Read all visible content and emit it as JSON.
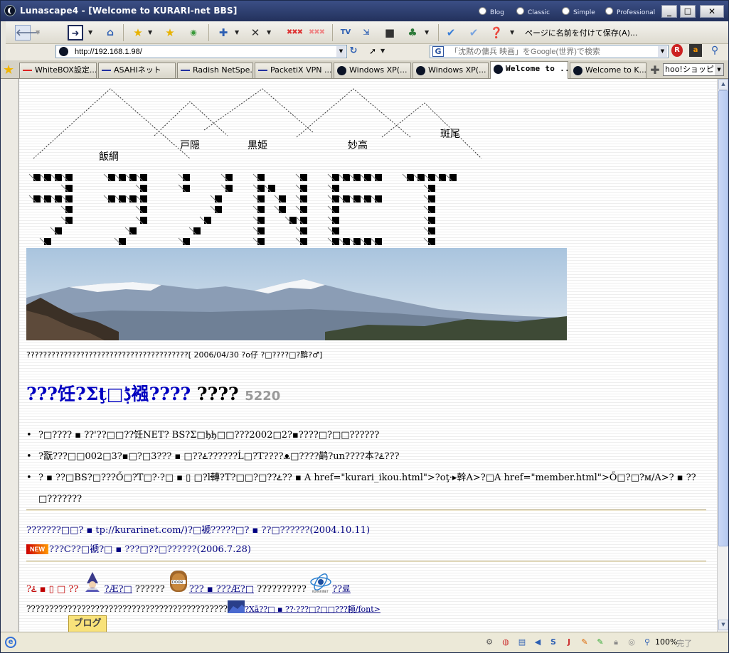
{
  "window": {
    "title": "Lunascape4 - [Welcome to KURARI-net BBS]",
    "modes": [
      "Blog",
      "Classic",
      "Simple",
      "Professional"
    ],
    "controls": {
      "minimize": "_",
      "maximize": "□",
      "close": "✕"
    }
  },
  "toolbar": {
    "save_label": "ページに名前を付けて保存(A)..."
  },
  "address": {
    "url": "http://192.168.1.98/",
    "search_placeholder": "「沈黙の傭兵 映画」をGoogle(世界)で検索"
  },
  "tabs": [
    {
      "label": "WhiteBOX設定...",
      "icon_color": "#d22"
    },
    {
      "label": "ASAHIネット",
      "icon_color": "#2230a0"
    },
    {
      "label": "Radish NetSpe...",
      "icon_color": "#2230a0"
    },
    {
      "label": "PacketiX VPN ...",
      "icon_color": "#2230a0"
    },
    {
      "label": "Windows XP(...",
      "icon_color": "#0b1326"
    },
    {
      "label": "Windows XP(...",
      "icon_color": "#0b1326"
    },
    {
      "label": "Welcome to ...",
      "icon_color": "#0b1326",
      "active": true
    },
    {
      "label": "Welcome to K...",
      "icon_color": "#0b1326"
    }
  ],
  "shopping_label": "hoo!ショッピング",
  "logo": {
    "peaks": [
      "飯綱",
      "戸隠",
      "黒姫",
      "妙高",
      "斑尾"
    ]
  },
  "page": {
    "caption": "???????????????????????????????????????[ 2006/04/30 ?o仔 ?□????□?黭?♂]",
    "heading_blue": "???饪?Σţ□ڋ襁????",
    "heading_black": "????",
    "counter": "5220",
    "notices": [
      "?□???? ▪ ??'??□□??饪NET? BS?Σ□ђђ□□???2002□2?▪????□?□□??????",
      "?翫???□□002□3?▪□?□3??? ▪ □??ۓ??????Ĺ□?T????ᴥ□????鹋?un????本?ۓ???",
      "? ▪ ??□BS?□???Ő□?T□?·?□ ▪ ▯ □?ŀ轉?T?□□?□??ۓ?? ▪ A href=\"kurari_ikou.html\">?oţ·▸幹A>?□A href=\"member.html\">Ő□?□?м/A>? ▪ ??□???????"
    ],
    "link1": "???????□□? ▪ tp://kurarinet.com/)?□褫?????□? ▪ ??□??????(2004.10.11)",
    "new_badge": "NEW",
    "link2": "???C??□褫?□ ▪ ???□??□??????(2006.7.28)",
    "row_red": "?ۓ ▪ ▯ □ ??",
    "row_link1": "?Æ?□",
    "row_mid": " ??????",
    "row_link2": "??? ▪ ???Æ?□",
    "row_mid2": " ??????????",
    "row_link3": "??료",
    "footer_text": "????????????????????????????????????????????",
    "footer_link": "?Xā??□ ▪ ??·???□?□□???頼/font>",
    "blog_label": "ブログ"
  },
  "status": {
    "zoom": "100%",
    "done": "完了"
  }
}
